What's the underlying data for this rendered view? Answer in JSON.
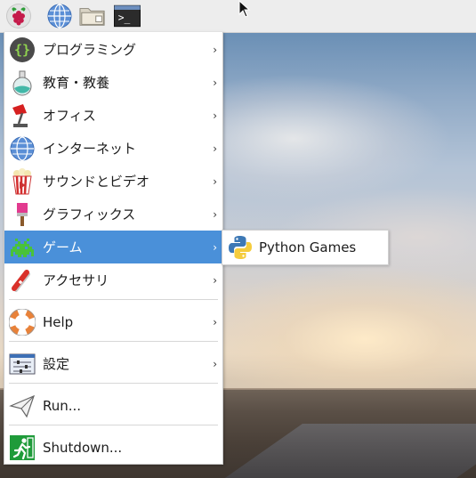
{
  "panel": {
    "launchers": [
      {
        "name": "raspberry-menu",
        "icon": "raspberry-icon"
      },
      {
        "name": "web-browser",
        "icon": "globe-icon"
      },
      {
        "name": "file-manager",
        "icon": "folder-icon"
      },
      {
        "name": "terminal",
        "icon": "terminal-icon",
        "glyph": ">_"
      }
    ]
  },
  "menu": {
    "items": [
      {
        "label": "プログラミング",
        "icon": "braces-icon",
        "has_submenu": true
      },
      {
        "label": "教育・教養",
        "icon": "flask-icon",
        "has_submenu": true
      },
      {
        "label": "オフィス",
        "icon": "desk-lamp-icon",
        "has_submenu": true
      },
      {
        "label": "インターネット",
        "icon": "globe-icon",
        "has_submenu": true
      },
      {
        "label": "サウンドとビデオ",
        "icon": "popcorn-icon",
        "has_submenu": true
      },
      {
        "label": "グラフィックス",
        "icon": "paintbrush-icon",
        "has_submenu": true
      },
      {
        "label": "ゲーム",
        "icon": "space-invader-icon",
        "has_submenu": true,
        "selected": true
      },
      {
        "label": "アクセサリ",
        "icon": "swiss-knife-icon",
        "has_submenu": true
      },
      {
        "label": "Help",
        "icon": "lifebuoy-icon",
        "has_submenu": true
      },
      {
        "label": "設定",
        "icon": "settings-panel-icon",
        "has_submenu": true
      },
      {
        "label": "Run...",
        "icon": "paper-plane-icon",
        "has_submenu": false
      },
      {
        "label": "Shutdown...",
        "icon": "exit-icon",
        "has_submenu": false
      }
    ],
    "arrow": "›"
  },
  "submenu": {
    "items": [
      {
        "label": "Python Games",
        "icon": "python-icon"
      }
    ]
  },
  "colors": {
    "selection": "#4a90d9",
    "panel": "#ededed"
  }
}
